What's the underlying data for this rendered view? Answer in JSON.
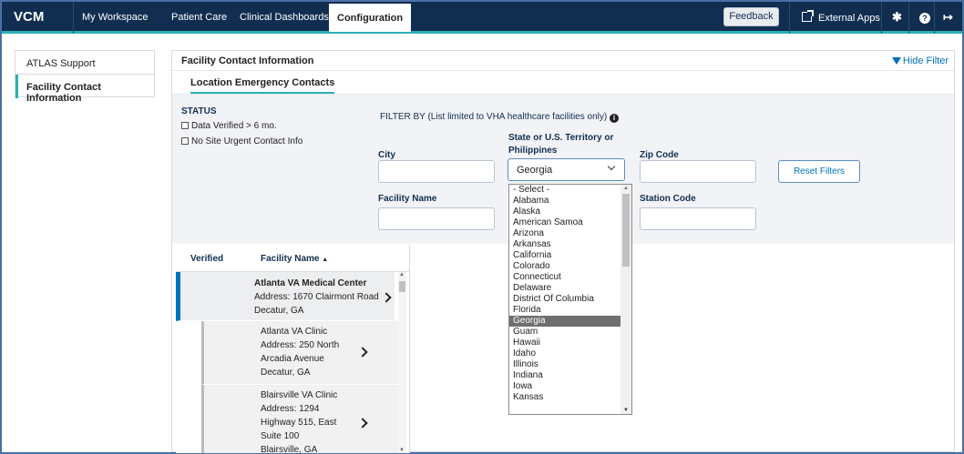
{
  "app": {
    "brand": "VCM"
  },
  "nav": {
    "tabs": [
      "My Workspace",
      "Patient Care",
      "Clinical Dashboards",
      "Configuration"
    ],
    "feedback": "Feedback",
    "external_apps": "External Apps",
    "icons": [
      "gear-icon",
      "help-icon",
      "sign-out-icon"
    ]
  },
  "sidebar": {
    "items": [
      {
        "label": "ATLAS Support"
      },
      {
        "label": "Facility Contact Information"
      }
    ]
  },
  "panel": {
    "title": "Facility Contact Information",
    "hide_filter": "Hide Filter",
    "subtab": "Location Emergency Contacts"
  },
  "filters": {
    "status_heading": "STATUS",
    "checkboxes": [
      "Data Verified > 6 mo.",
      "No Site Urgent Contact Info"
    ],
    "filter_by": "FILTER BY",
    "filter_note": "(List limited to VHA healthcare facilities only)",
    "city_label": "City",
    "state_label_1": "State or U.S. Territory or",
    "state_label_2": "Philippines",
    "state_value": "Georgia",
    "zip_label": "Zip Code",
    "facility_label": "Facility Name",
    "station_label": "Station Code",
    "reset": "Reset Filters"
  },
  "results": {
    "columns": [
      "Verified",
      "Facility Name"
    ],
    "sort_indicator": "▲",
    "rows": [
      {
        "name": "Atlanta VA Medical Center",
        "lines": [
          "Address: 1670 Clairmont Road",
          "Decatur, GA"
        ]
      },
      {
        "name": "Atlanta VA Clinic",
        "lines": [
          "Address: 250 North",
          "Arcadia Avenue",
          "Decatur, GA"
        ]
      },
      {
        "name": "Blairsville VA Clinic",
        "lines": [
          "Address: 1294",
          "Highway 515, East",
          "Suite 100",
          "Blairsville, GA"
        ]
      }
    ]
  },
  "state_dropdown": {
    "selected": "Georgia",
    "options": [
      "- Select -",
      "Alabama",
      "Alaska",
      "American Samoa",
      "Arizona",
      "Arkansas",
      "California",
      "Colorado",
      "Connecticut",
      "Delaware",
      "District Of Columbia",
      "Florida",
      "Georgia",
      "Guam",
      "Hawaii",
      "Idaho",
      "Illinois",
      "Indiana",
      "Iowa",
      "Kansas"
    ]
  },
  "colors": {
    "nav_bg": "#112e51",
    "accent": "#2ab1b3",
    "link": "#0071bc"
  }
}
